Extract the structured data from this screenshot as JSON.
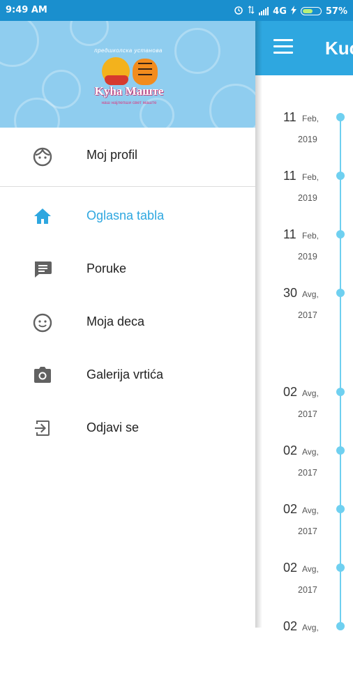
{
  "status_bar": {
    "time": "9:49 AM",
    "network": "4G",
    "battery": "57%",
    "battery_level": 0.57
  },
  "app": {
    "title": "Kuć"
  },
  "drawer": {
    "header": {
      "logo_top_text": "предшколска установа",
      "logo_name": "Kyha Maште",
      "logo_sub": "наш најлепши свет маште"
    },
    "profile": {
      "label": "Moj profil",
      "icon": "face-icon"
    },
    "items": [
      {
        "label": "Oglasna tabla",
        "icon": "home-icon",
        "active": true
      },
      {
        "label": "Poruke",
        "icon": "message-icon",
        "active": false
      },
      {
        "label": "Moja deca",
        "icon": "child-face-icon",
        "active": false
      },
      {
        "label": "Galerija vrtića",
        "icon": "camera-icon",
        "active": false
      },
      {
        "label": "Odjavi se",
        "icon": "logout-icon",
        "active": false
      }
    ]
  },
  "timeline": {
    "entries": [
      {
        "day": "11",
        "month": "Feb,",
        "year": "2019"
      },
      {
        "day": "11",
        "month": "Feb,",
        "year": "2019"
      },
      {
        "day": "11",
        "month": "Feb,",
        "year": "2019"
      },
      {
        "day": "30",
        "month": "Avg,",
        "year": "2017"
      },
      {
        "day": "02",
        "month": "Avg,",
        "year": "2017"
      },
      {
        "day": "02",
        "month": "Avg,",
        "year": "2017"
      },
      {
        "day": "02",
        "month": "Avg,",
        "year": "2017"
      },
      {
        "day": "02",
        "month": "Avg,",
        "year": "2017"
      },
      {
        "day": "02",
        "month": "Avg,",
        "year": ""
      }
    ]
  },
  "colors": {
    "status_bar": "#1a8fce",
    "app_bar": "#2ea7e0",
    "accent": "#2ea7e0",
    "timeline": "#6fd0f0",
    "drawer_header": "#8fcdef"
  }
}
